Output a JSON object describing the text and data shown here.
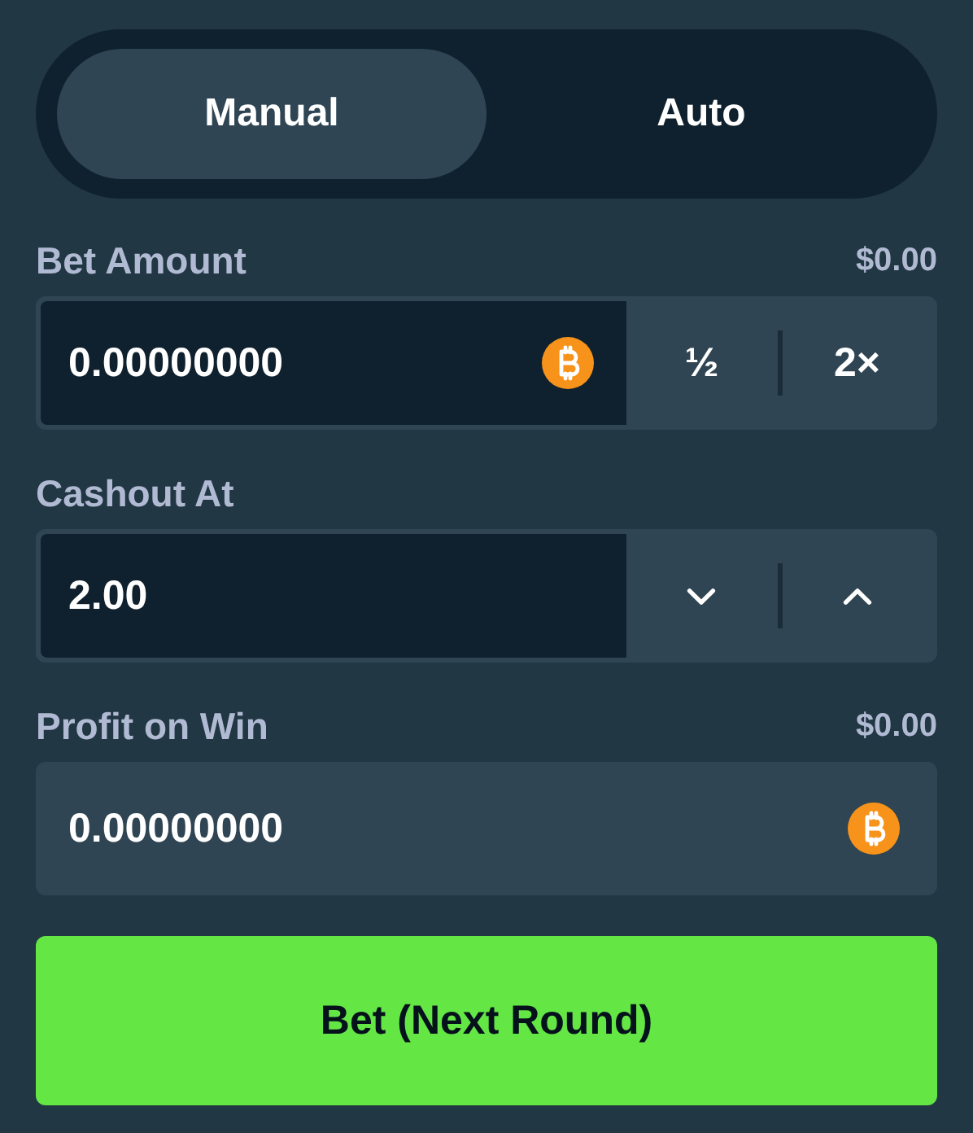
{
  "mode_tabs": [
    {
      "label": "Manual",
      "selected": true
    },
    {
      "label": "Auto",
      "selected": false
    }
  ],
  "fields": [
    {
      "kind": "amount",
      "label": "Bet Amount",
      "reading": "$0.00",
      "value": "0.00000000",
      "buttons": [
        "½",
        "2×"
      ]
    },
    {
      "kind": "stepper",
      "label": "Cashout At",
      "value": "2.00"
    },
    {
      "kind": "readonly",
      "label": "Profit on Win",
      "reading": "$0.00",
      "value": "0.00000000"
    }
  ],
  "bet_button": {
    "label": "Bet (Next Round)"
  }
}
